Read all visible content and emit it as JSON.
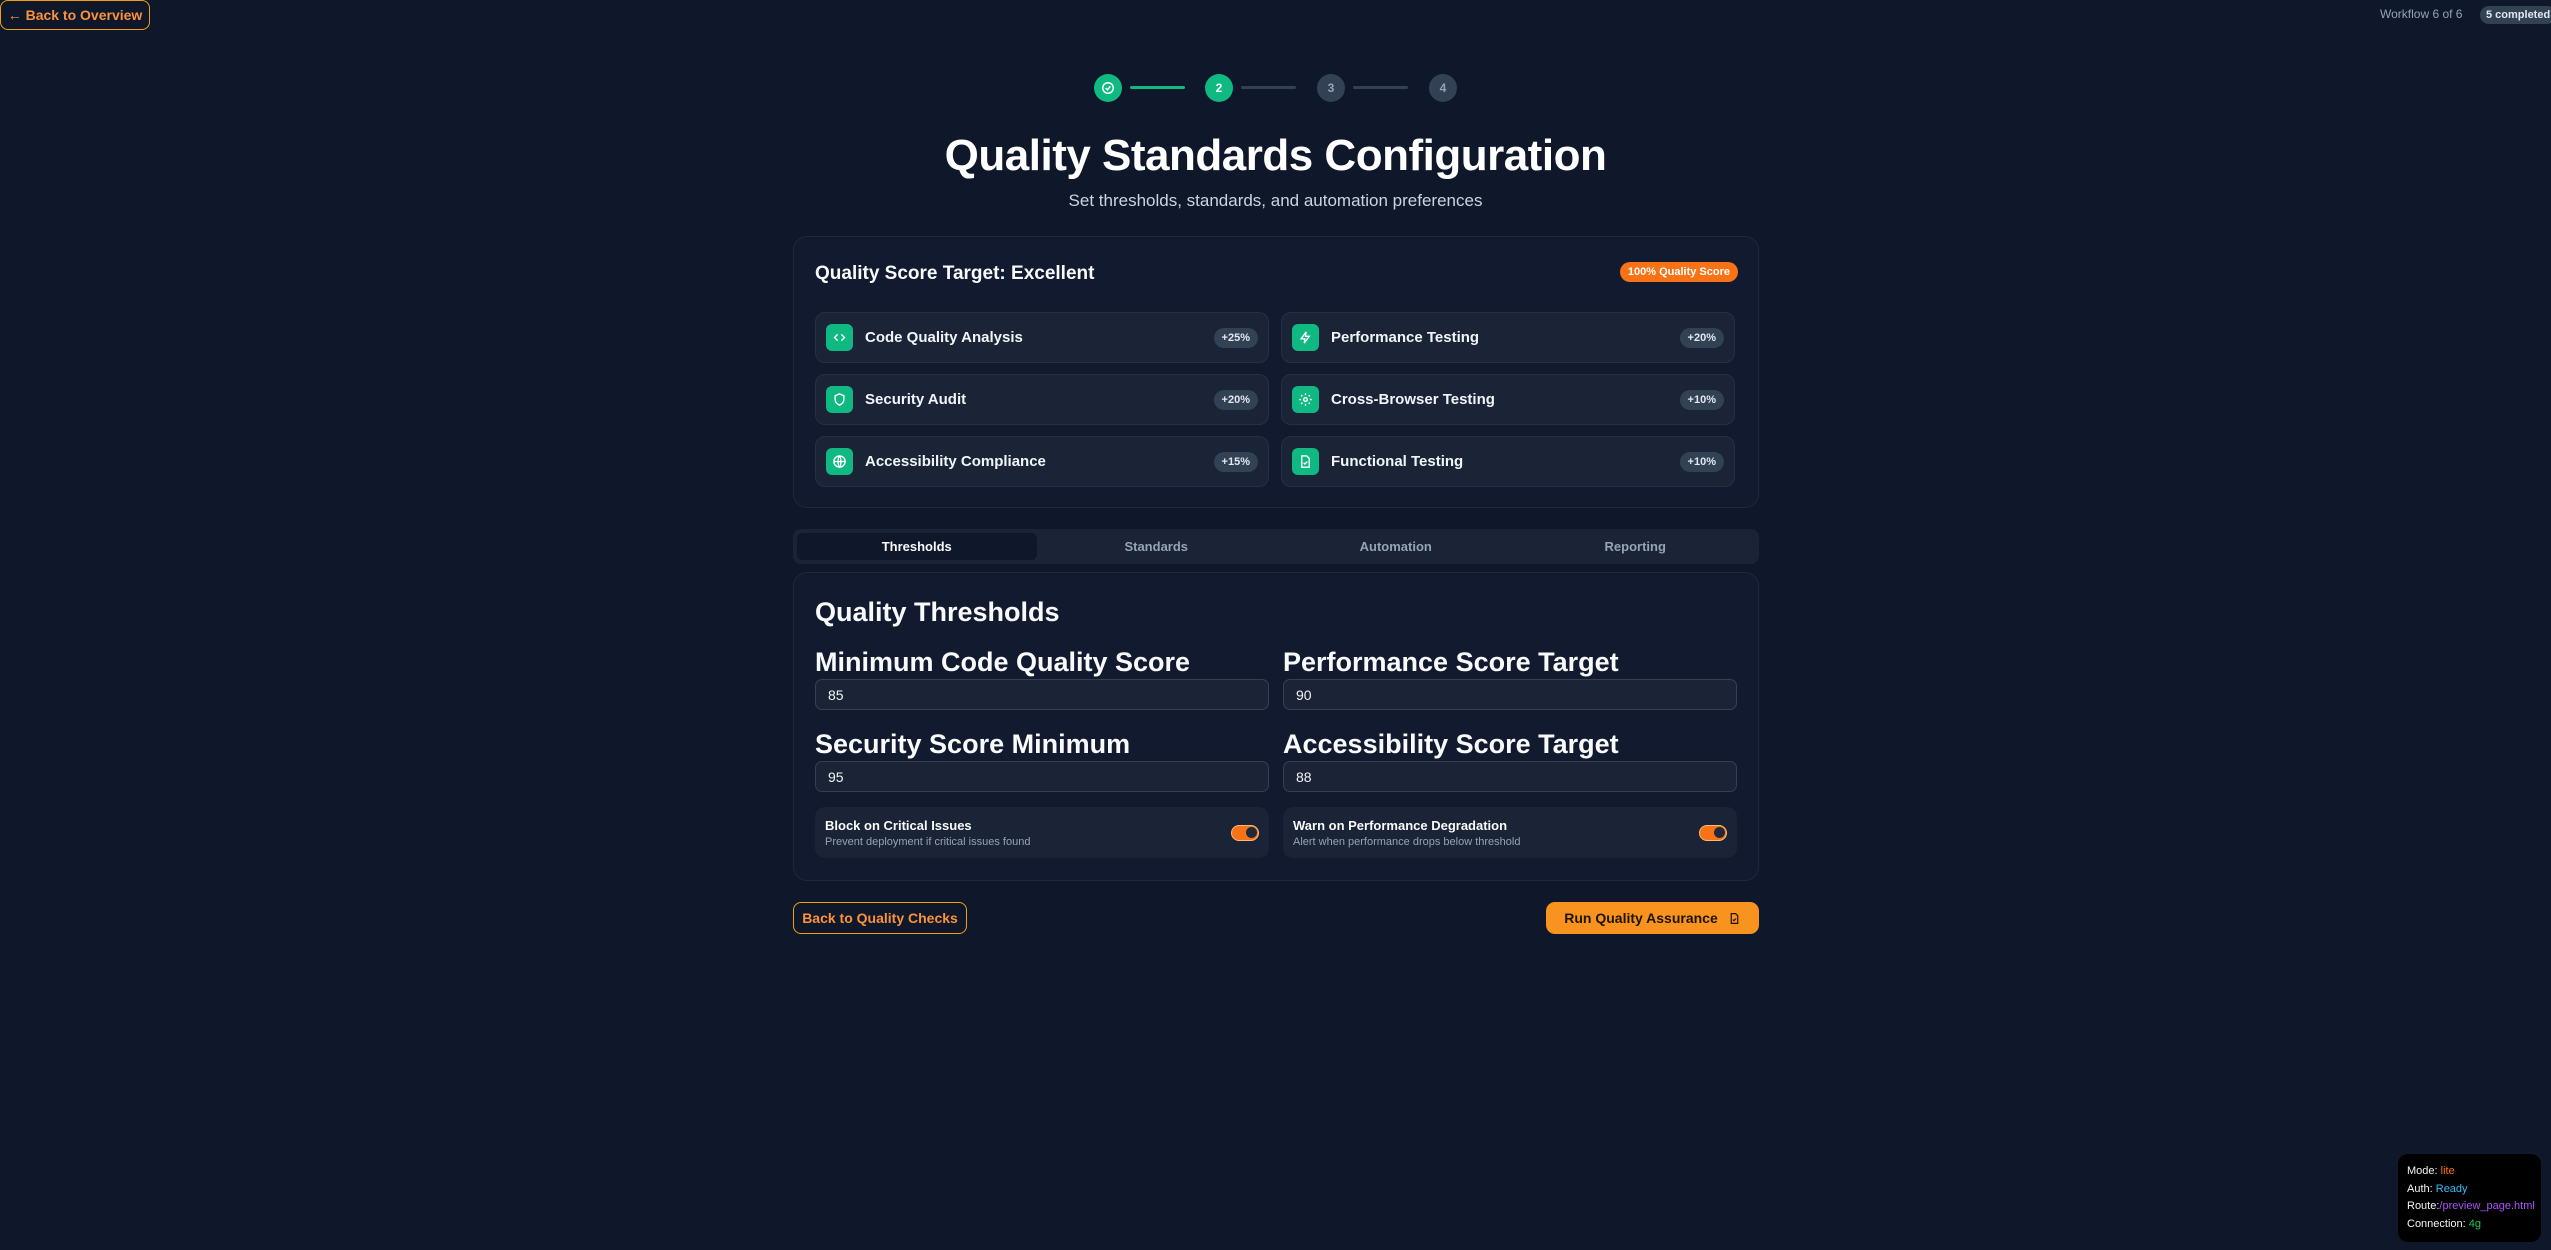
{
  "topbar": {
    "back_label": "← Back to Overview",
    "workflow_label": "Workflow 6 of 6",
    "completed_badge": "5 completed"
  },
  "stepper": {
    "steps": [
      "",
      "2",
      "3",
      "4"
    ],
    "active_step": 2
  },
  "header": {
    "title": "Quality Standards Configuration",
    "subtitle": "Set thresholds, standards, and automation preferences"
  },
  "score_card": {
    "title": "Quality Score Target: Excellent",
    "badge": "100% Quality Score",
    "items": [
      {
        "label": "Code Quality Analysis",
        "pct": "+25%",
        "icon": "code-icon"
      },
      {
        "label": "Performance Testing",
        "pct": "+20%",
        "icon": "zap-icon"
      },
      {
        "label": "Security Audit",
        "pct": "+20%",
        "icon": "shield-icon"
      },
      {
        "label": "Cross-Browser Testing",
        "pct": "+10%",
        "icon": "gear-icon"
      },
      {
        "label": "Accessibility Compliance",
        "pct": "+15%",
        "icon": "globe-icon"
      },
      {
        "label": "Functional Testing",
        "pct": "+10%",
        "icon": "file-icon"
      }
    ]
  },
  "tabs": [
    "Thresholds",
    "Standards",
    "Automation",
    "Reporting"
  ],
  "thresholds": {
    "title": "Quality Thresholds",
    "fields": [
      {
        "label": "Minimum Code Quality Score",
        "value": "85"
      },
      {
        "label": "Performance Score Target",
        "value": "90"
      },
      {
        "label": "Security Score Minimum",
        "value": "95"
      },
      {
        "label": "Accessibility Score Target",
        "value": "88"
      }
    ],
    "toggles": [
      {
        "title": "Block on Critical Issues",
        "desc": "Prevent deployment if critical issues found",
        "on": true
      },
      {
        "title": "Warn on Performance Degradation",
        "desc": "Alert when performance drops below threshold",
        "on": true
      }
    ]
  },
  "actions": {
    "back_label": "Back to Quality Checks",
    "run_label": "Run Quality Assurance"
  },
  "debug": {
    "mode_key": "Mode:",
    "mode_val": "lite",
    "auth_key": "Auth:",
    "auth_val": "Ready",
    "route_key": "Route:",
    "route_val": "/preview_page.html",
    "conn_key": "Connection:",
    "conn_val": "4g"
  },
  "colors": {
    "accent_green": "#10b981",
    "accent_orange": "#f97316",
    "background": "#0f172a"
  }
}
